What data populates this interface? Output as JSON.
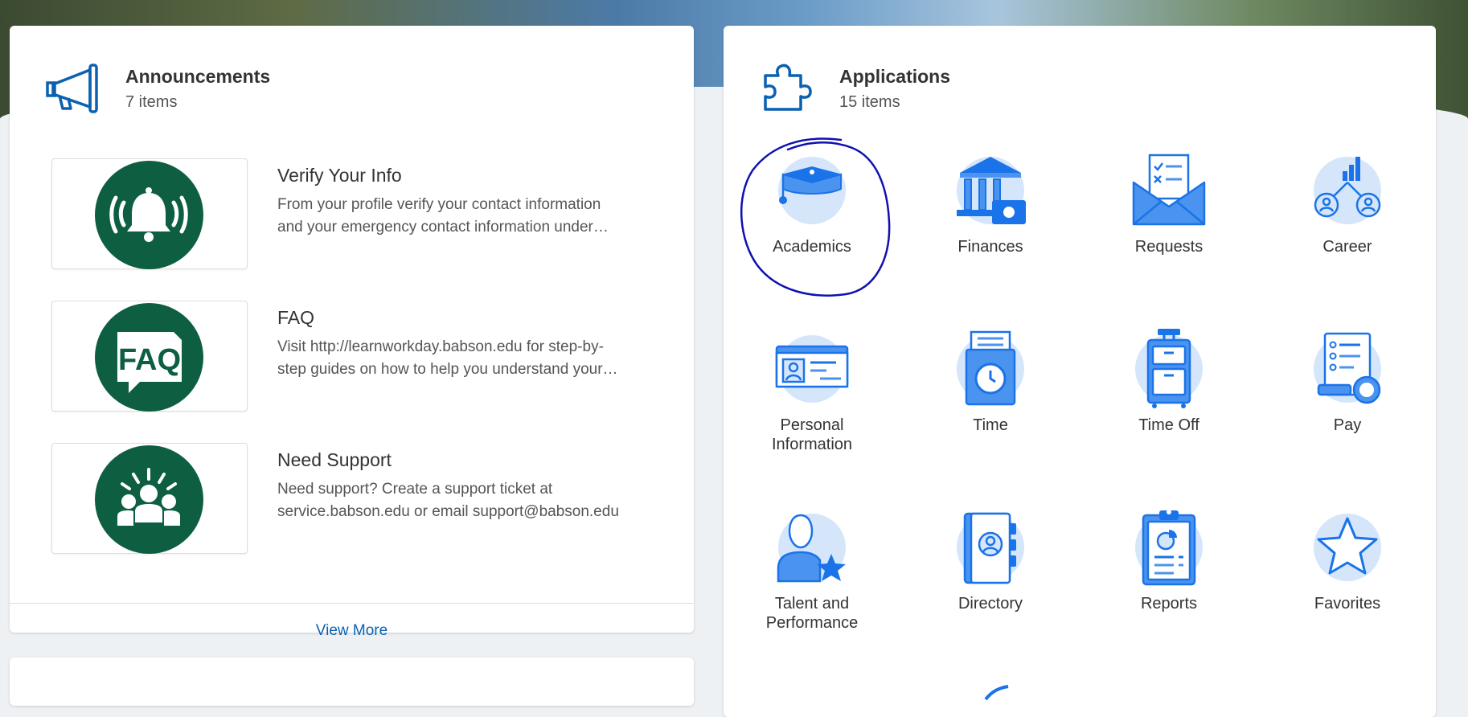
{
  "announcements": {
    "title": "Announcements",
    "count": "7 items",
    "items": [
      {
        "title": "Verify Your Info",
        "line1": "From your profile verify your contact information",
        "line2": "and your emergency contact information under…",
        "icon": "bell-icon"
      },
      {
        "title": "FAQ",
        "line1": "Visit http://learnworkday.babson.edu for step-by-",
        "line2": "step guides on how to help you understand your…",
        "icon": "faq-icon",
        "icon_text": "FAQ"
      },
      {
        "title": "Need Support",
        "line1": "Need support? Create a support ticket at",
        "line2": "service.babson.edu or email support@babson.edu",
        "icon": "people-icon"
      }
    ],
    "view_more": "View More"
  },
  "applications": {
    "title": "Applications",
    "count": "15 items",
    "apps": [
      {
        "label": "Academics",
        "icon": "graduation-cap-icon"
      },
      {
        "label": "Finances",
        "icon": "bank-icon"
      },
      {
        "label": "Requests",
        "icon": "envelope-icon"
      },
      {
        "label": "Career",
        "icon": "career-icon"
      },
      {
        "label1": "Personal",
        "label2": "Information",
        "icon": "id-card-icon"
      },
      {
        "label": "Time",
        "icon": "time-clock-icon"
      },
      {
        "label": "Time Off",
        "icon": "suitcase-icon"
      },
      {
        "label": "Pay",
        "icon": "pay-icon"
      },
      {
        "label1": "Talent and",
        "label2": "Performance",
        "icon": "talent-icon"
      },
      {
        "label": "Directory",
        "icon": "directory-icon"
      },
      {
        "label": "Reports",
        "icon": "reports-icon"
      },
      {
        "label": "Favorites",
        "icon": "star-icon"
      }
    ]
  },
  "colors": {
    "accent": "#0b61b0",
    "icon_blue": "#1a73e8",
    "icon_bg": "#d5e6fb",
    "announcement_green": "#0e5e42",
    "annotation_ink": "#1010b0"
  }
}
